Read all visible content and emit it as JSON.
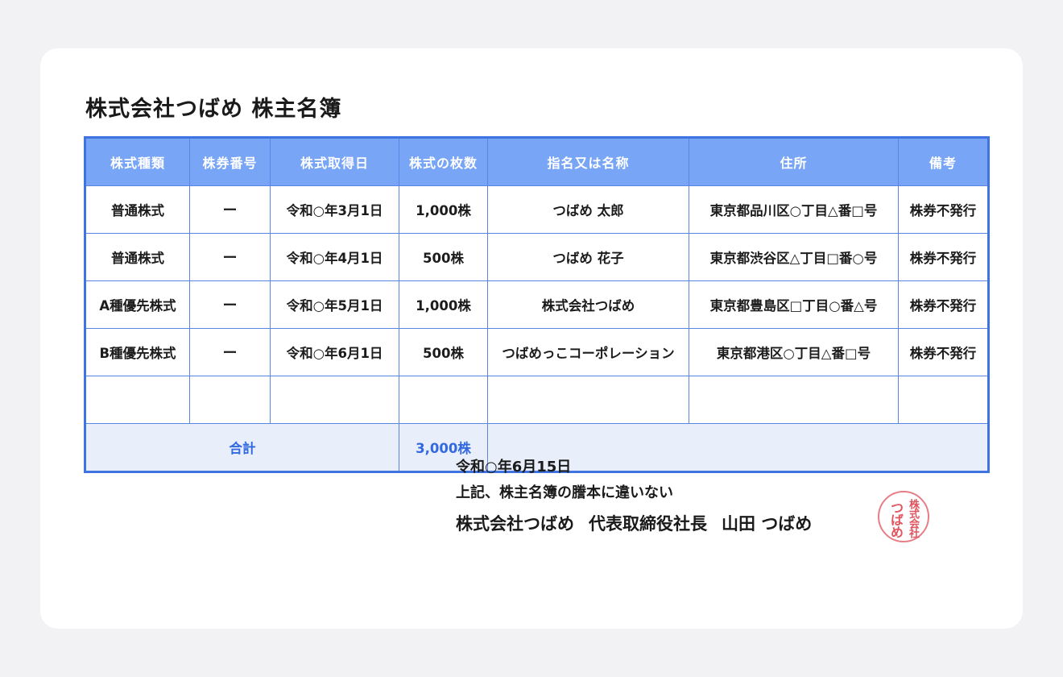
{
  "document": {
    "title": "株式会社つばめ 株主名簿"
  },
  "table": {
    "headers": [
      "株式種類",
      "株券番号",
      "株式取得日",
      "株式の枚数",
      "指名又は名称",
      "住所",
      "備考"
    ],
    "rows": [
      [
        "普通株式",
        "ー",
        "令和○年3月1日",
        "1,000株",
        "つばめ 太郎",
        "東京都品川区○丁目△番□号",
        "株券不発行"
      ],
      [
        "普通株式",
        "ー",
        "令和○年4月1日",
        "500株",
        "つばめ 花子",
        "東京都渋谷区△丁目□番○号",
        "株券不発行"
      ],
      [
        "A種優先株式",
        "ー",
        "令和○年5月1日",
        "1,000株",
        "株式会社つばめ",
        "東京都豊島区□丁目○番△号",
        "株券不発行"
      ],
      [
        "B種優先株式",
        "ー",
        "令和○年6月1日",
        "500株",
        "つばめっこコーポレーション",
        "東京都港区○丁目△番□号",
        "株券不発行"
      ],
      [
        "",
        "",
        "",
        "",
        "",
        "",
        ""
      ]
    ],
    "total_label": "合計",
    "total_value": "3,000株"
  },
  "footer": {
    "date": "令和○年6月15日",
    "certification": "上記、株主名簿の謄本に違いない",
    "company": "株式会社つばめ",
    "position": "代表取締役社長",
    "representative": "山田 つばめ"
  },
  "seal": {
    "text": "株式会社つばめ",
    "color": "#e0555f"
  },
  "colors": {
    "header_bg": "#78a5f6",
    "border": "#3f73e0",
    "total_bg": "#e9effa",
    "total_text": "#3268e0"
  }
}
